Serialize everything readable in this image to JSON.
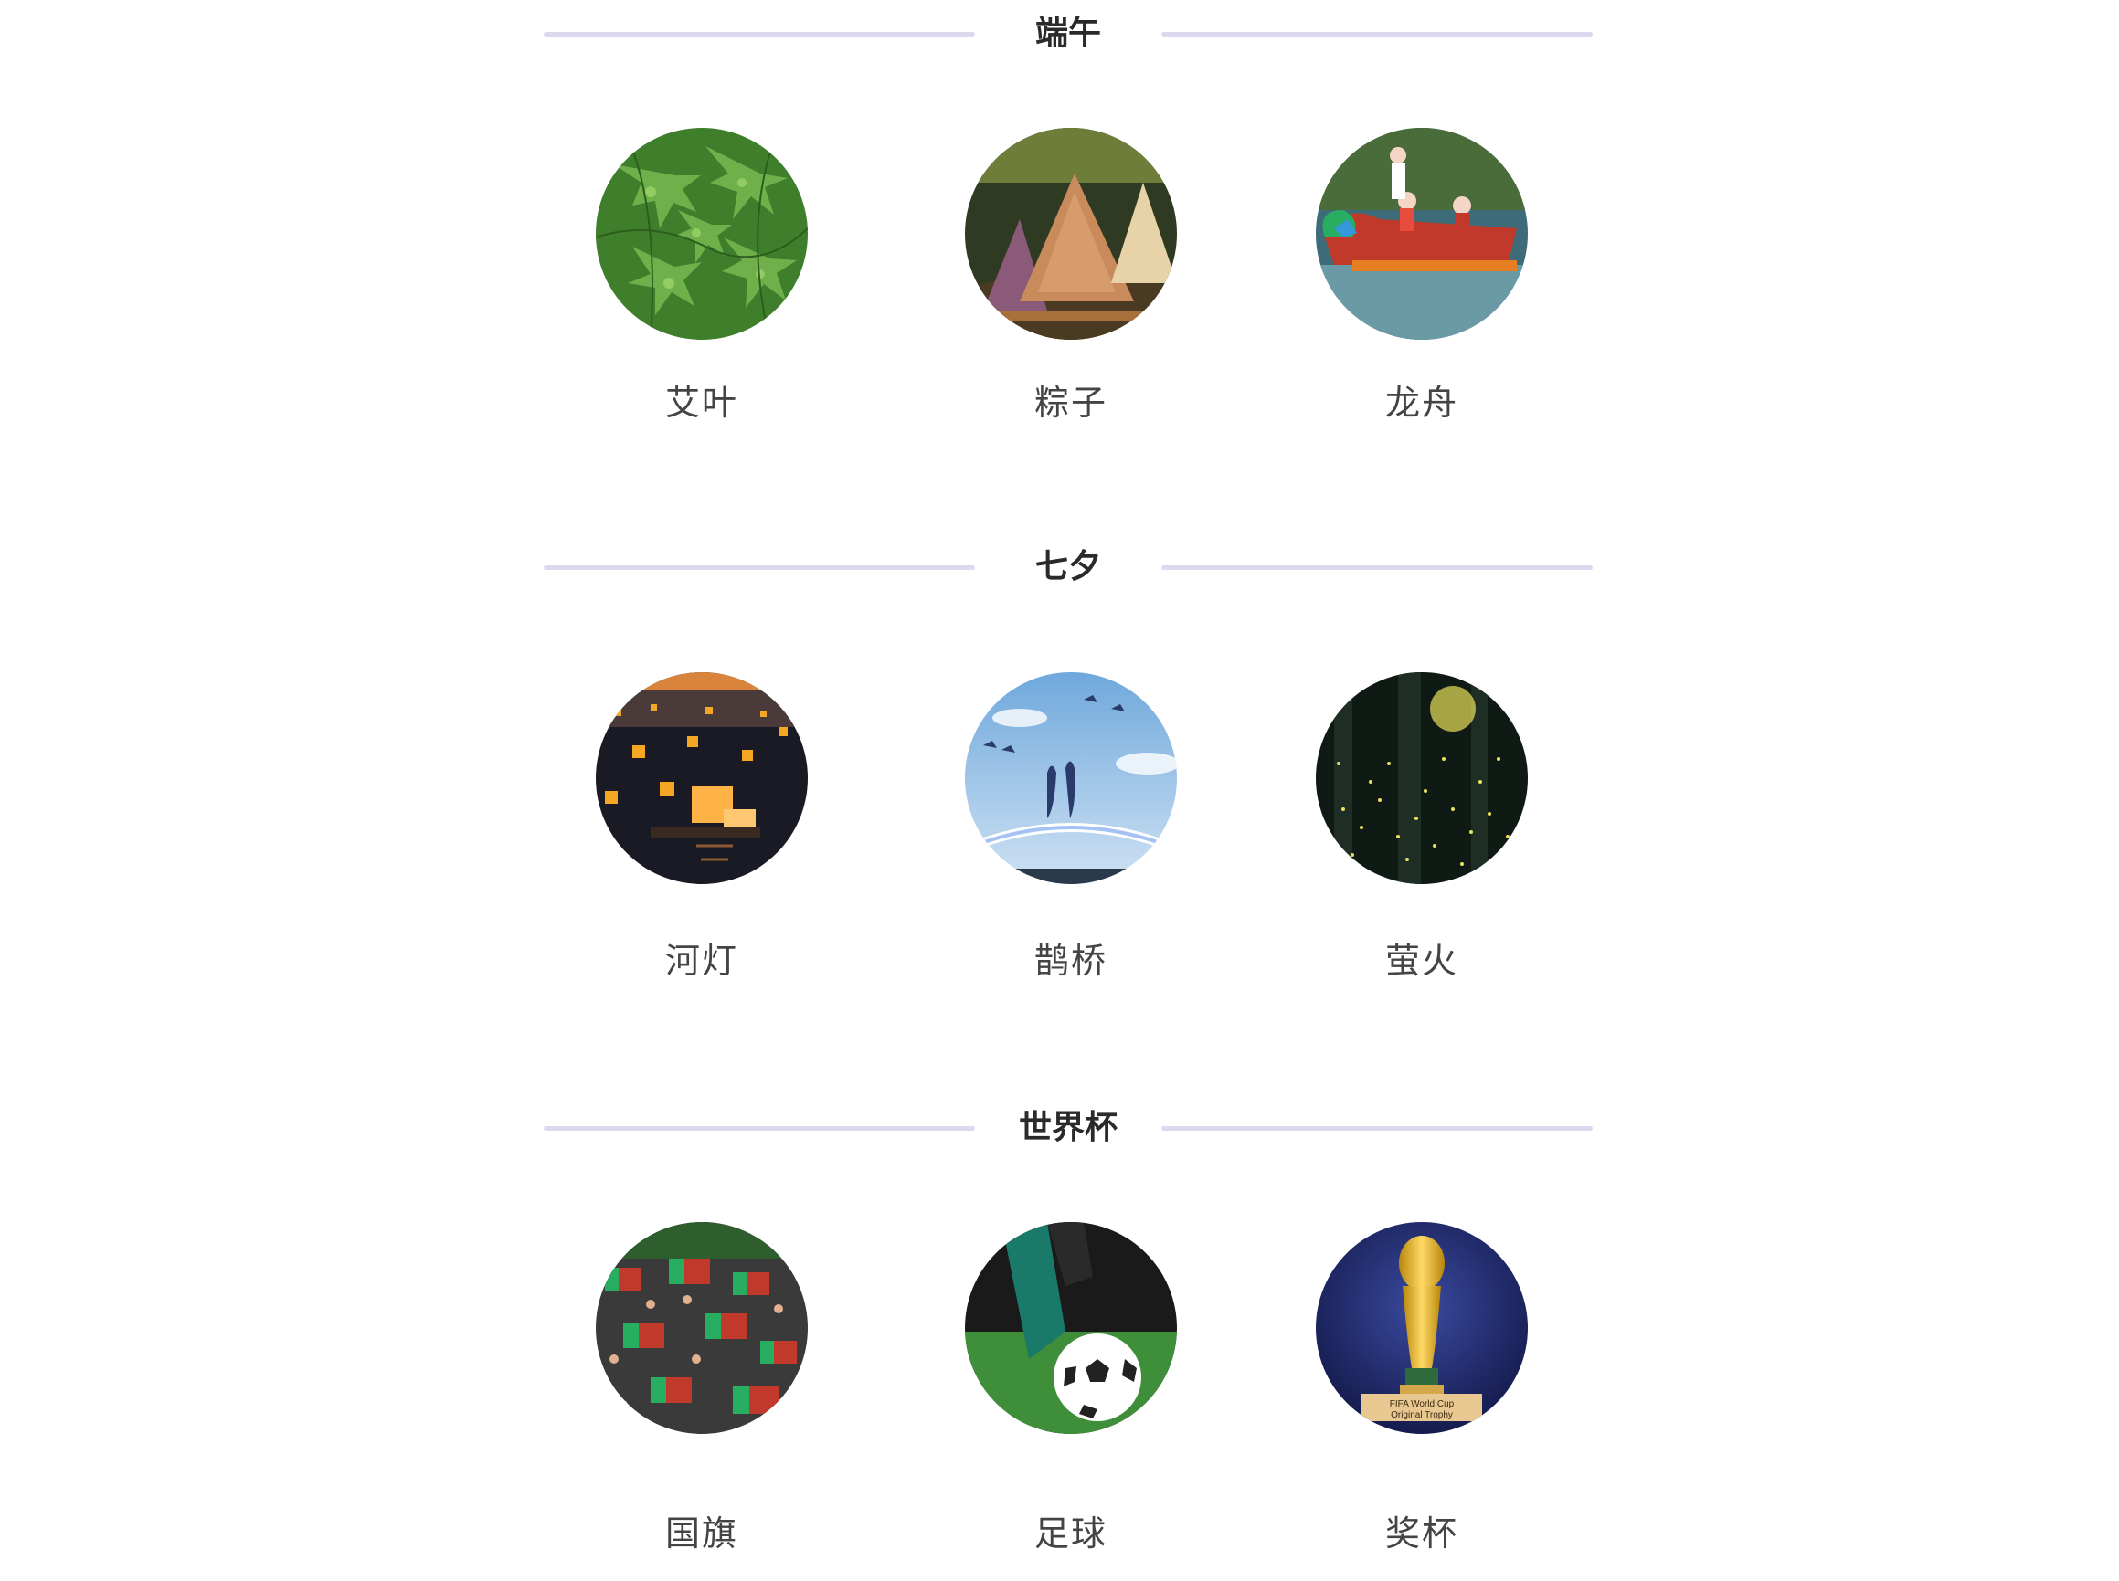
{
  "sections": [
    {
      "title": "端午",
      "items": [
        {
          "label": "艾叶",
          "image": "mugwort-leaves"
        },
        {
          "label": "粽子",
          "image": "zongzi-dumplings"
        },
        {
          "label": "龙舟",
          "image": "dragon-boat"
        }
      ]
    },
    {
      "title": "七夕",
      "items": [
        {
          "label": "河灯",
          "image": "river-lanterns"
        },
        {
          "label": "鹊桥",
          "image": "magpie-bridge"
        },
        {
          "label": "萤火",
          "image": "fireflies"
        }
      ]
    },
    {
      "title": "世界杯",
      "items": [
        {
          "label": "国旗",
          "image": "national-flags-crowd"
        },
        {
          "label": "足球",
          "image": "soccer-ball"
        },
        {
          "label": "奖杯",
          "image": "world-cup-trophy"
        }
      ]
    }
  ],
  "colors": {
    "divider": "#dcd8ef",
    "title_text": "#2a2a2a",
    "label_text": "#444444"
  }
}
